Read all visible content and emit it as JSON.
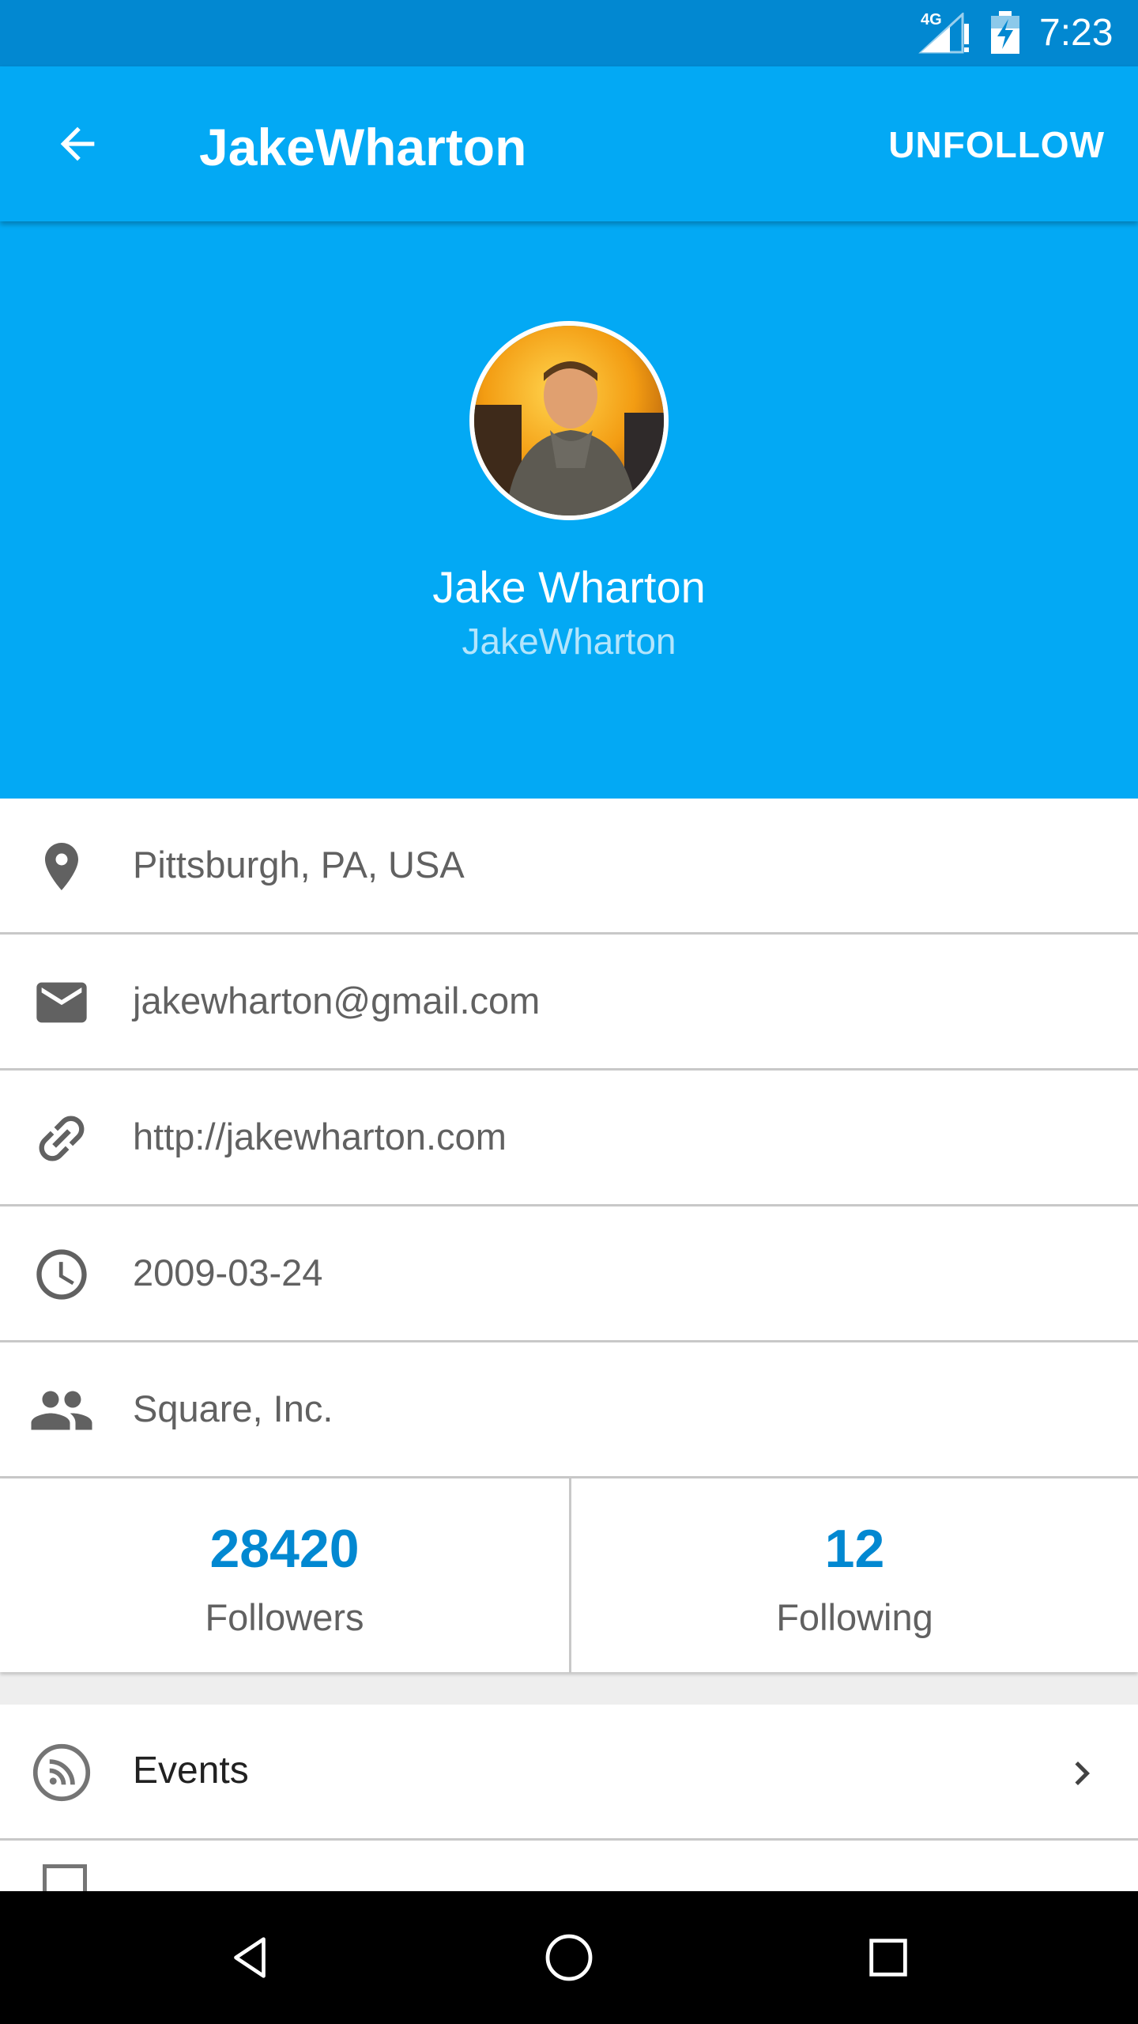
{
  "status_bar": {
    "network": "4G",
    "time": "7:23"
  },
  "toolbar": {
    "title": "JakeWharton",
    "action_label": "UNFOLLOW",
    "back_icon": "arrow-back-icon"
  },
  "profile": {
    "full_name": "Jake Wharton",
    "login": "JakeWharton",
    "avatar_icon": "avatar-photo"
  },
  "details": [
    {
      "icon": "location-pin-icon",
      "text": "Pittsburgh, PA, USA"
    },
    {
      "icon": "email-icon",
      "text": "jakewharton@gmail.com"
    },
    {
      "icon": "link-icon",
      "text": "http://jakewharton.com"
    },
    {
      "icon": "clock-icon",
      "text": "2009-03-24"
    },
    {
      "icon": "group-icon",
      "text": "Square, Inc."
    }
  ],
  "stats": {
    "followers": {
      "value": "28420",
      "label": "Followers"
    },
    "following": {
      "value": "12",
      "label": "Following"
    }
  },
  "menu": [
    {
      "icon": "rss-feed-icon",
      "label": "Events"
    }
  ],
  "colors": {
    "status_bar": "#0288d1",
    "primary": "#03a9f4",
    "accent_text": "#0288d1",
    "secondary_text": "#616161",
    "divider": "#c8c8c8"
  }
}
